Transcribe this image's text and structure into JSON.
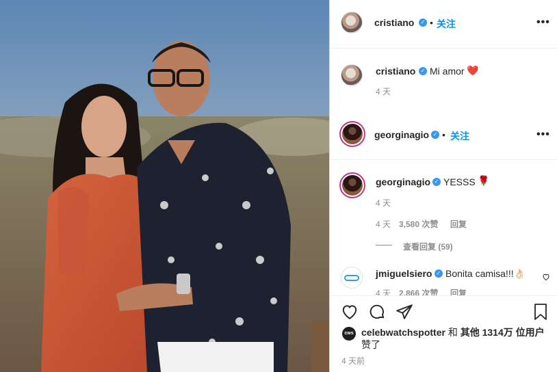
{
  "post": {
    "author": "cristiano",
    "follow_label": "关注",
    "separator": "•",
    "more_label": "•••"
  },
  "caption": {
    "username": "cristiano",
    "text": "Mi amor",
    "emoji": "❤️",
    "time": "4 天"
  },
  "reply_header": {
    "username": "georginagio",
    "follow_label": "关注",
    "separator": "•",
    "more_label": "•••"
  },
  "comments": [
    {
      "username": "georginagio",
      "text": "YESSS",
      "emoji": "🌹",
      "time": "4 天",
      "meta_time": "4 天",
      "likes": "3,580 次赞",
      "reply_label": "回复",
      "view_replies": "查看回复 (59)"
    },
    {
      "username": "jmiguelsiero",
      "text": "Bonita camisa!!!👌🏻",
      "meta_time": "4 天",
      "likes": "2,866 次赞",
      "reply_label": "回复"
    }
  ],
  "likes_line": {
    "avatar_text": "cws",
    "username": "celebwatchspotter",
    "and": "和",
    "others": "其他 1314万 位用户",
    "liked": "赞了"
  },
  "post_time": "4 天前",
  "icons": [
    "heart-icon",
    "comment-icon",
    "share-icon",
    "bookmark-icon",
    "verified-icon",
    "more-icon"
  ],
  "colors": {
    "accent": "#0095f6",
    "verified": "#3897f0",
    "muted": "#8e8e8e",
    "text": "#262626"
  }
}
